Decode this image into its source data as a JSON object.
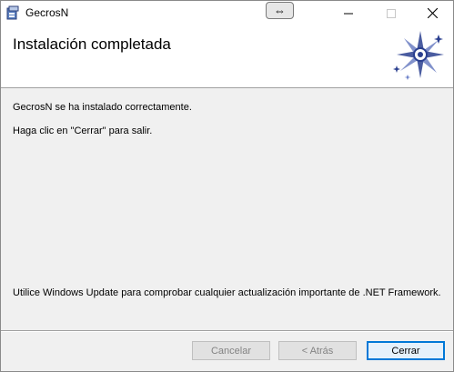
{
  "window": {
    "title": "GecrosN",
    "restore_glyph": "⇔",
    "controls": {
      "minimize": "minimize-icon",
      "maximize": "maximize-icon",
      "close": "close-icon"
    }
  },
  "header": {
    "title": "Instalación completada",
    "logo": "sparkle-logo-icon"
  },
  "body": {
    "line1": "GecrosN  se ha instalado correctamente.",
    "line2": "Haga clic en \"Cerrar\" para salir.",
    "line3": "Utilice Windows Update para comprobar cualquier actualización importante de .NET Framework."
  },
  "footer": {
    "cancel_label": "Cancelar",
    "back_label": "< Atrás",
    "close_label": "Cerrar",
    "cancel_enabled": false,
    "back_enabled": false
  },
  "colors": {
    "accent": "#0078d7",
    "logo_blue": "#2a3f8f"
  }
}
